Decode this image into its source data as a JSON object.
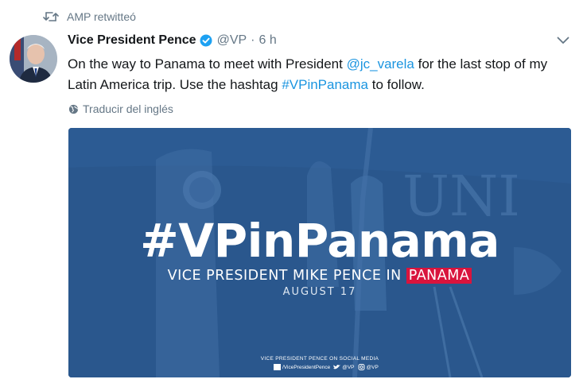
{
  "retweet": {
    "icon": "retweet-icon",
    "label": "AMP retwitteó"
  },
  "tweet": {
    "author_name": "Vice President Pence",
    "handle": "@VP",
    "separator": "·",
    "time": "6 h",
    "text_parts": [
      {
        "text": "On the way to Panama to meet with President ",
        "type": "plain"
      },
      {
        "text": "@jc_varela",
        "type": "link"
      },
      {
        "text": " for the last stop of my Latin America trip. Use the hashtag ",
        "type": "plain"
      },
      {
        "text": "#VPinPanama",
        "type": "link"
      },
      {
        "text": " to follow.",
        "type": "plain"
      }
    ],
    "translate_label": "Traducir del inglés"
  },
  "media": {
    "hashtag": "#VPinPanama",
    "subtitle_prefix": "VICE PRESIDENT MIKE PENCE IN ",
    "subtitle_highlight": "PANAMA",
    "date": "AUGUST 17",
    "social_title": "VICE PRESIDENT PENCE ON SOCIAL MEDIA",
    "facebook": "/VicePresidentPence",
    "twitter": "@VP",
    "instagram": "@VP"
  },
  "colors": {
    "link": "#1b95e0",
    "secondary_text": "#657786",
    "verified": "#1da1f2",
    "overlay_blue": "#2c5b93",
    "highlight_red": "#d9143d"
  }
}
